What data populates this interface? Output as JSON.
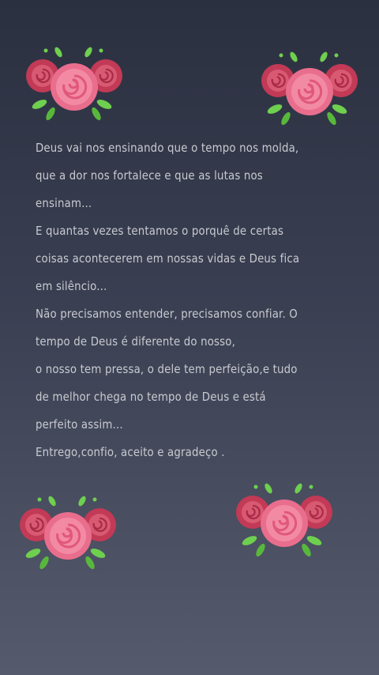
{
  "poem": {
    "lines": [
      "Deus vai nos ensinando que o tempo nos molda,",
      "que a dor nos fortalece e que as lutas nos",
      "ensinam...",
      "E quantas vezes tentamos o porquê de certas",
      "coisas acontecerem em nossas vidas e Deus fica",
      "em silêncio...",
      "Não precisamos entender, precisamos confiar. O",
      "tempo de Deus é diferente do nosso,",
      "o nosso tem pressa, o dele tem perfeição,e tudo",
      "de melhor chega no tempo de Deus e está",
      "perfeito assim...",
      "Entrego,confio, aceito e agradeço ."
    ]
  },
  "colors": {
    "background_top": "#2b3040",
    "background_bottom": "#555a6c",
    "text": "#c9cad0",
    "rose_dark": "#c23a56",
    "rose_light": "#f38aa4",
    "leaf": "#6fcf4f"
  },
  "decorations": {
    "icon": "rose-bouquet-icon"
  }
}
